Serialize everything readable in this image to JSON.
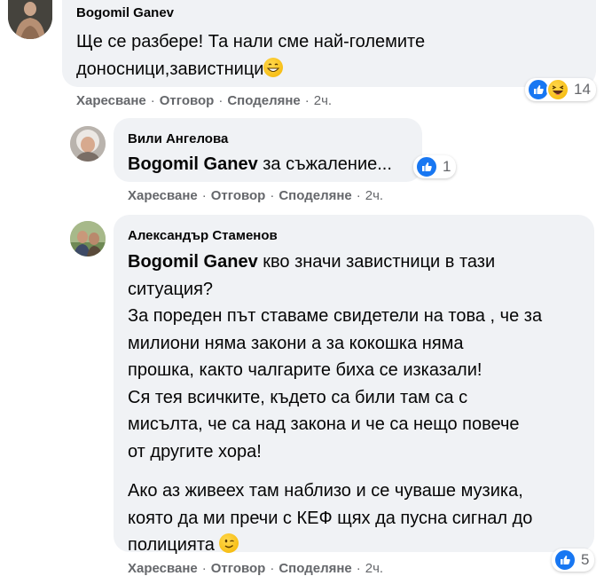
{
  "comments": [
    {
      "author": "Bogomil Ganev",
      "lines": [
        "Ще се разбере! Та нали сме най-големите",
        "доносници,завистници"
      ],
      "reaction_count": "14",
      "actions": {
        "like": "Харесване",
        "reply": "Отговор",
        "share": "Споделяне",
        "time": "2ч."
      }
    },
    {
      "author": "Вили Ангелова",
      "mention": "Bogomil Ganev",
      "text": " за съжаление...",
      "reaction_count": "1",
      "actions": {
        "like": "Харесване",
        "reply": "Отговор",
        "share": "Споделяне",
        "time": "2ч."
      }
    },
    {
      "author": "Александър Стаменов",
      "mention": "Bogomil Ganev",
      "first_line": " кво значи завистници в тази",
      "lines": [
        "ситуация?",
        "За пореден път ставаме свидетели на това , че за",
        "милиони няма закони а за кокошка няма",
        "прошка, както чалгарите биха се изказали!",
        "Ся тея всичките, където са били там са с",
        "мисълта, че са над закона и че са нещо повече",
        "от другите хора!"
      ],
      "lines2": [
        "Ако аз живеех там наблизо и се чуваше музика,",
        "която да ми пречи с КЕФ щях да пусна сигнал до",
        "полицията"
      ],
      "reaction_count": "5",
      "actions": {
        "like": "Харесване",
        "reply": "Отговор",
        "share": "Споделяне",
        "time": "2ч."
      }
    }
  ],
  "colors": {
    "bubble": "#f0f2f5",
    "like_blue": "#1877f2",
    "meta": "#65676b"
  }
}
